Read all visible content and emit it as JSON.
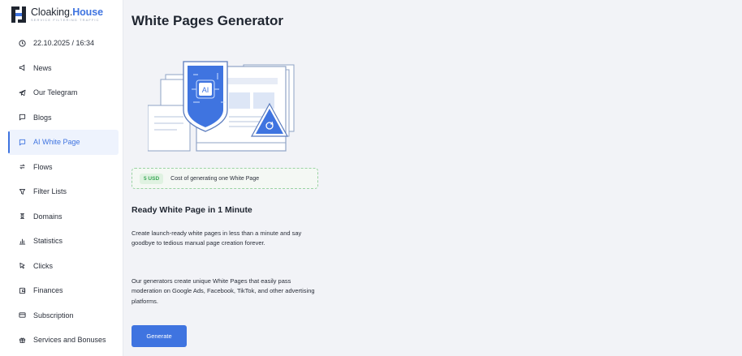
{
  "brand": {
    "name_plain": "Cloaking.",
    "name_accent": "House",
    "tagline": "SERVICE FILTERING TRAFFIC"
  },
  "sidebar": {
    "items": [
      {
        "label": "22.10.2025 / 16:34",
        "icon": "clock-icon"
      },
      {
        "label": "News",
        "icon": "megaphone-icon"
      },
      {
        "label": "Our Telegram",
        "icon": "telegram-icon"
      },
      {
        "label": "Blogs",
        "icon": "chat-bubble-icon"
      },
      {
        "label": "AI White Page",
        "icon": "page-icon",
        "active": true
      },
      {
        "label": "Flows",
        "icon": "flows-icon"
      },
      {
        "label": "Filter Lists",
        "icon": "filter-icon"
      },
      {
        "label": "Domains",
        "icon": "domains-icon"
      },
      {
        "label": "Statistics",
        "icon": "bar-chart-icon"
      },
      {
        "label": "Clicks",
        "icon": "cursor-icon"
      },
      {
        "label": "Finances",
        "icon": "wallet-icon"
      },
      {
        "label": "Subscription",
        "icon": "card-icon"
      },
      {
        "label": "Services and Bonuses",
        "icon": "gift-icon"
      }
    ]
  },
  "main": {
    "title": "White Pages Generator",
    "illustration_label": "AI",
    "cost": {
      "badge": "5 USD",
      "text": "Cost of generating one White Page"
    },
    "heading": "Ready White Page in 1 Minute",
    "paragraph1": "Create launch-ready white pages in less than a minute and say goodbye to tedious manual page creation forever.",
    "paragraph2": "Our generators create unique White Pages that easily pass moderation on Google Ads, Facebook, TikTok, and other advertising platforms.",
    "generate_label": "Generate"
  },
  "colors": {
    "accent": "#3f74e0",
    "success": "#3aa856",
    "background": "#f2f3f7"
  }
}
